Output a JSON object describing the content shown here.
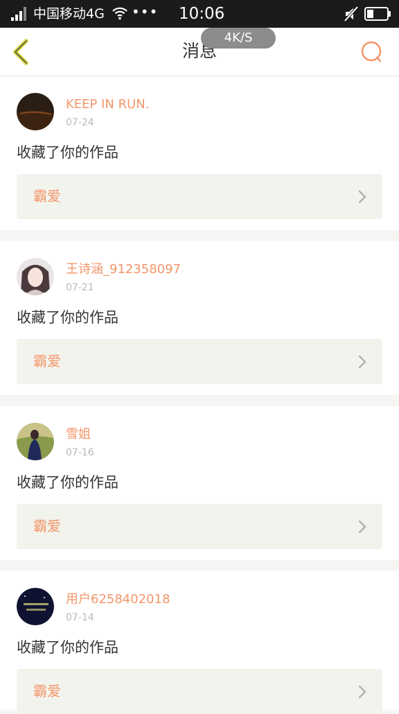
{
  "status_bar": {
    "carrier": "中国移动4G",
    "dots": "•••",
    "time": "10:06"
  },
  "header": {
    "title": "消息",
    "speed_badge": "4K/S",
    "accent_color": "#f3966a"
  },
  "messages": [
    {
      "username": "KEEP IN RUN.",
      "date": "07-24",
      "action": "收藏了你的作品",
      "work_title": "霸爱"
    },
    {
      "username": "王诗涵_912358097",
      "date": "07-21",
      "action": "收藏了你的作品",
      "work_title": "霸爱"
    },
    {
      "username": "雪姐",
      "date": "07-16",
      "action": "收藏了你的作品",
      "work_title": "霸爱"
    },
    {
      "username": "用户6258402018",
      "date": "07-14",
      "action": "收藏了你的作品",
      "work_title": "霸爱"
    }
  ],
  "icons": {
    "back": "chevron-left-icon",
    "search": "search-icon",
    "work_link": "chevron-right-icon"
  }
}
